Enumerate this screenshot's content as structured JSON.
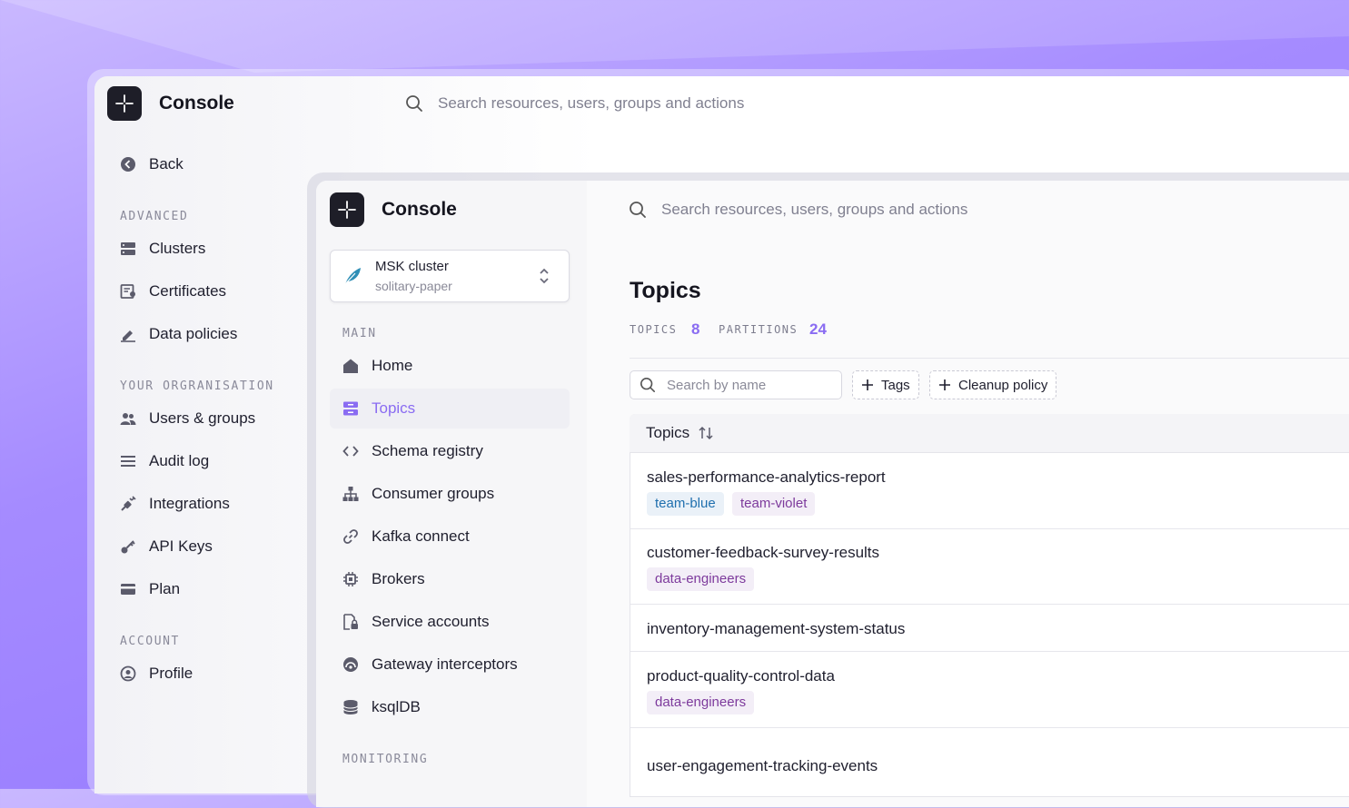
{
  "back_window": {
    "title": "Console",
    "search_placeholder": "Search resources, users, groups and actions",
    "back_label": "Back",
    "sections": {
      "advanced": "ADVANCED",
      "organisation": "YOUR ORGRANISATION",
      "account": "ACCOUNT"
    },
    "items": {
      "clusters": "Clusters",
      "certificates": "Certificates",
      "data_policies": "Data policies",
      "users_groups": "Users & groups",
      "audit_log": "Audit log",
      "integrations": "Integrations",
      "api_keys": "API Keys",
      "plan": "Plan",
      "profile": "Profile"
    }
  },
  "front_window": {
    "title": "Console",
    "search_placeholder": "Search resources, users, groups and actions",
    "cluster": {
      "name": "MSK cluster",
      "sub": "solitary-paper"
    },
    "sections": {
      "main": "MAIN",
      "monitoring": "MONITORING"
    },
    "items": {
      "home": "Home",
      "topics": "Topics",
      "schema_registry": "Schema registry",
      "consumer_groups": "Consumer groups",
      "kafka_connect": "Kafka connect",
      "brokers": "Brokers",
      "service_accounts": "Service accounts",
      "gateway_interceptors": "Gateway interceptors",
      "ksqldb": "ksqlDB"
    },
    "accent_color": "#8a6cf2"
  },
  "topics_page": {
    "title": "Topics",
    "stats": {
      "topics_label": "TOPICS",
      "topics_value": "8",
      "partitions_label": "PARTITIONS",
      "partitions_value": "24"
    },
    "search_placeholder": "Search by name",
    "filters": {
      "tags": "Tags",
      "cleanup": "Cleanup policy"
    },
    "table_header": "Topics",
    "rows": [
      {
        "name": "sales-performance-analytics-report",
        "tags": [
          "team-blue",
          "team-violet"
        ]
      },
      {
        "name": "customer-feedback-survey-results",
        "tags": [
          "data-engineers"
        ]
      },
      {
        "name": "inventory-management-system-status",
        "tags": []
      },
      {
        "name": "product-quality-control-data",
        "tags": [
          "data-engineers"
        ]
      },
      {
        "name": "user-engagement-tracking-events",
        "tags": []
      }
    ]
  }
}
